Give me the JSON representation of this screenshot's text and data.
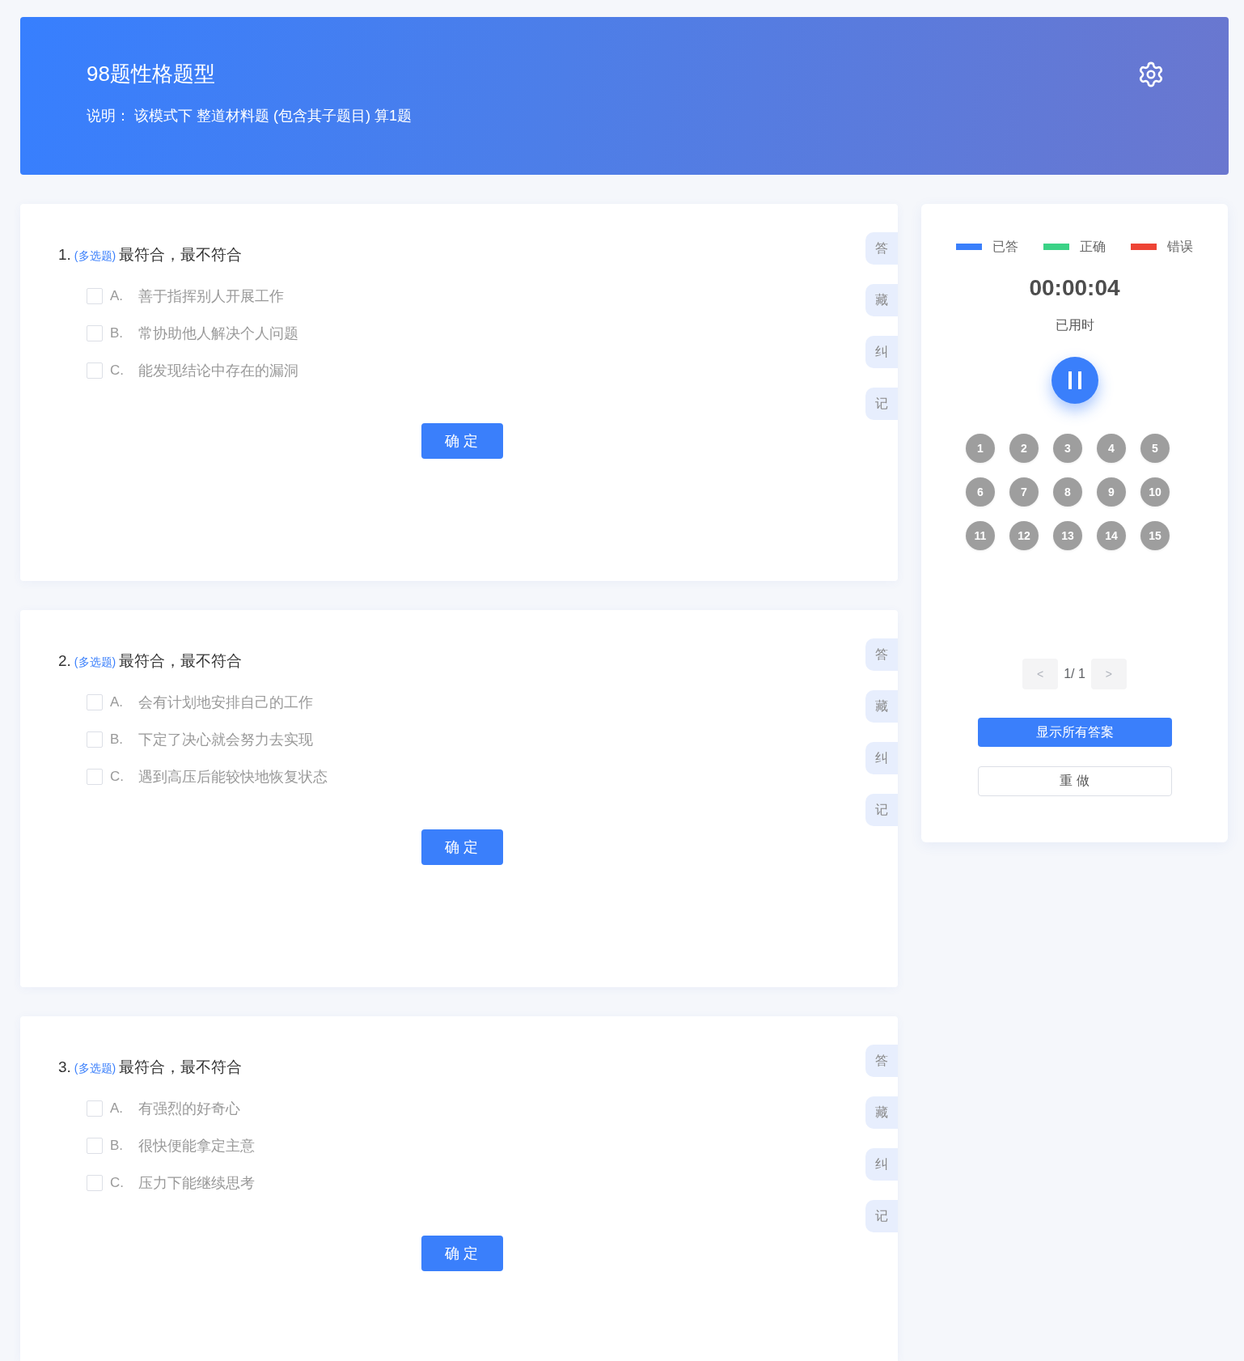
{
  "header": {
    "title": "98题性格题型",
    "description": "说明： 该模式下 整道材料题 (包含其子题目) 算1题"
  },
  "questions": [
    {
      "number": "1.",
      "type": "(多选题)",
      "stem": "最符合，最不符合",
      "options": [
        {
          "letter": "A.",
          "text": "善于指挥别人开展工作",
          "checked": false
        },
        {
          "letter": "B.",
          "text": "常协助他人解决个人问题",
          "checked": false
        },
        {
          "letter": "C.",
          "text": "能发现结论中存在的漏洞",
          "checked": false
        }
      ],
      "confirm": "确 定",
      "side_tabs": [
        {
          "label": "答"
        },
        {
          "label": "藏"
        },
        {
          "label": "纠"
        },
        {
          "label": "记"
        }
      ]
    },
    {
      "number": "2.",
      "type": "(多选题)",
      "stem": "最符合，最不符合",
      "options": [
        {
          "letter": "A.",
          "text": "会有计划地安排自己的工作",
          "checked": false
        },
        {
          "letter": "B.",
          "text": "下定了决心就会努力去实现",
          "checked": false
        },
        {
          "letter": "C.",
          "text": "遇到高压后能较快地恢复状态",
          "checked": false
        }
      ],
      "confirm": "确 定",
      "side_tabs": [
        {
          "label": "答"
        },
        {
          "label": "藏"
        },
        {
          "label": "纠"
        },
        {
          "label": "记"
        }
      ]
    },
    {
      "number": "3.",
      "type": "(多选题)",
      "stem": "最符合，最不符合",
      "options": [
        {
          "letter": "A.",
          "text": "有强烈的好奇心",
          "checked": false
        },
        {
          "letter": "B.",
          "text": "很快便能拿定主意",
          "checked": false
        },
        {
          "letter": "C.",
          "text": "压力下能继续思考",
          "checked": false
        }
      ],
      "confirm": "确 定",
      "side_tabs": [
        {
          "label": "答"
        },
        {
          "label": "藏"
        },
        {
          "label": "纠"
        },
        {
          "label": "记"
        }
      ]
    }
  ],
  "panel": {
    "legend": [
      {
        "label": "已答",
        "color": "#3a7ffb"
      },
      {
        "label": "正确",
        "color": "#3bd286"
      },
      {
        "label": "错误",
        "color": "#ee4435"
      }
    ],
    "timer": "00:00:04",
    "timer_label": "已用时",
    "numbers": [
      {
        "label": "1",
        "answered": false
      },
      {
        "label": "2",
        "answered": false
      },
      {
        "label": "3",
        "answered": false
      },
      {
        "label": "4",
        "answered": false
      },
      {
        "label": "5",
        "answered": false
      },
      {
        "label": "6",
        "answered": false
      },
      {
        "label": "7",
        "answered": false
      },
      {
        "label": "8",
        "answered": false
      },
      {
        "label": "9",
        "answered": false
      },
      {
        "label": "10",
        "answered": false
      },
      {
        "label": "11",
        "answered": false
      },
      {
        "label": "12",
        "answered": false
      },
      {
        "label": "13",
        "answered": false
      },
      {
        "label": "14",
        "answered": false
      },
      {
        "label": "15",
        "answered": false
      }
    ],
    "pager": {
      "prev": {
        "label": "<",
        "disabled": true
      },
      "page": "1/ 1",
      "next": {
        "label": ">",
        "disabled": true
      }
    },
    "show_answers": "显示所有答案",
    "redo": "重 做"
  }
}
